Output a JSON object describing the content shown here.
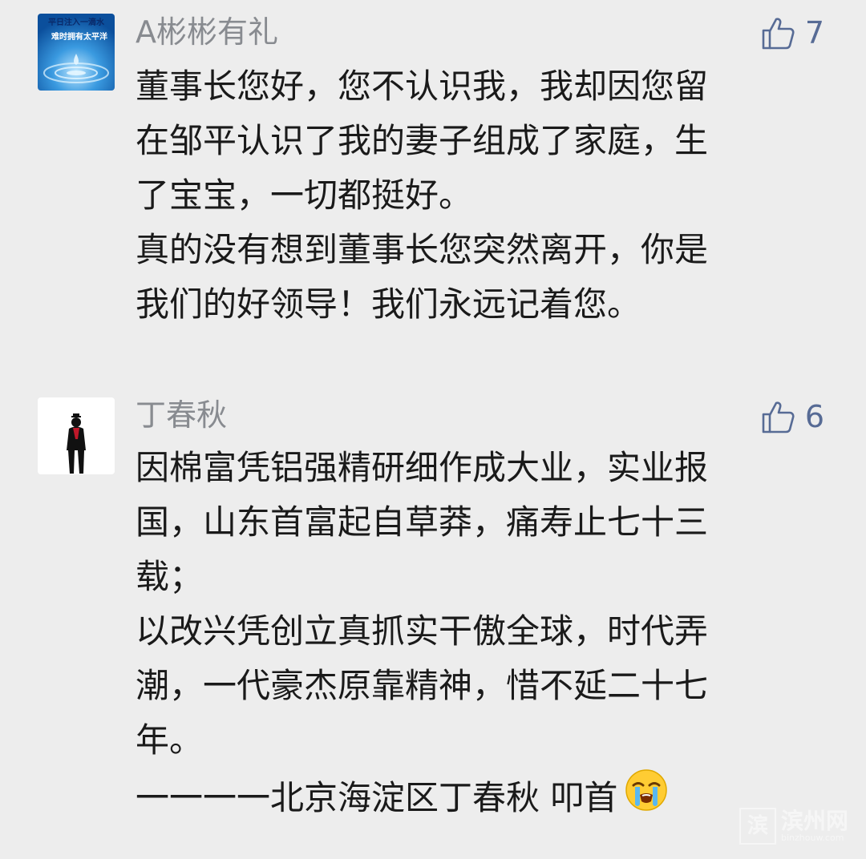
{
  "comments": [
    {
      "author": "A彬彬有礼",
      "likes": "7",
      "avatar": {
        "line1": "平日注入一滴水",
        "line2": "难时拥有太平洋"
      },
      "lines": [
        "董事长您好，您不认识我，我却因您留",
        "在邹平认识了我的妻子组成了家庭，生",
        "了宝宝，一切都挺好。",
        "真的没有想到董事长您突然离开，你是",
        "我们的好领导！我们永远记着您。"
      ]
    },
    {
      "author": "丁春秋",
      "likes": "6",
      "lines": [
        "因棉富凭铝强精研细作成大业，实业报",
        "国，山东首富起自草莽，痛寿止七十三",
        "载；",
        "以改兴凭创立真抓实干傲全球，时代弄",
        "潮，一代豪杰原靠精神，惜不延二十七",
        "年。"
      ],
      "signature": "一一一一北京海淀区丁春秋 叩首"
    }
  ],
  "icons": {
    "like": "thumbs-up-icon",
    "crying_emoji": "loudly-crying-face-icon"
  },
  "colors": {
    "background": "#ededed",
    "author": "#888b90",
    "like": "#576b95",
    "text": "#1a1a1a"
  },
  "watermark": {
    "mark": "滨",
    "name": "滨州网",
    "sub": "binzhouw.com"
  }
}
